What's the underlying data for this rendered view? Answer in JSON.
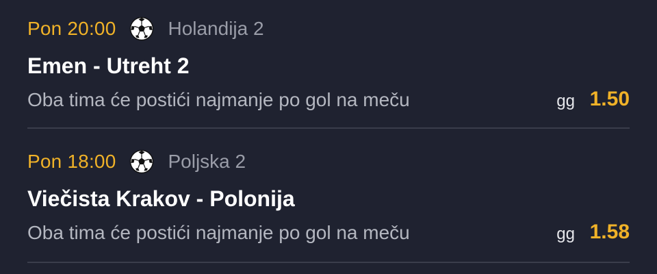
{
  "matches": [
    {
      "time": "Pon 20:00",
      "sport_icon": "soccer-ball-icon",
      "league": "Holandija 2",
      "teams": "Emen - Utreht 2",
      "market": "Oba tima će postići najmanje po gol na meču",
      "pick": "gg",
      "odds": "1.50"
    },
    {
      "time": "Pon 18:00",
      "sport_icon": "soccer-ball-icon",
      "league": "Poljska 2",
      "teams": "Viečista Krakov - Polonija",
      "market": "Oba tima će postići najmanje po gol na meču",
      "pick": "gg",
      "odds": "1.58"
    }
  ],
  "colors": {
    "background": "#1f2230",
    "accent": "#f0b228",
    "muted": "#9a9da8",
    "divider": "#3a3d4b"
  }
}
